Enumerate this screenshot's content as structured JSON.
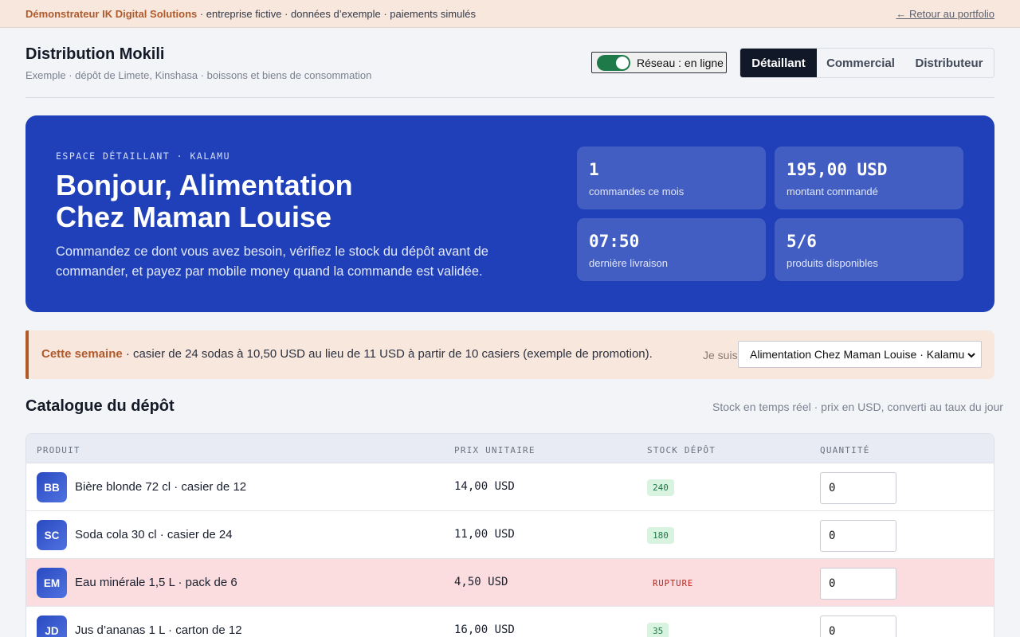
{
  "demo_bar": {
    "brand": "Démonstrateur IK Digital Solutions",
    "notes": " · entreprise fictive · données d’exemple · paiements simulés",
    "back_link": "← Retour au portfolio"
  },
  "header": {
    "title": "Distribution Mokili",
    "subtitle": "Exemple · dépôt de Limete, Kinshasa · boissons et biens de consommation",
    "network": {
      "label": "Réseau : en ligne",
      "on": true,
      "color": "#1f7a4a"
    },
    "roles": [
      "Détaillant",
      "Commercial",
      "Distributeur"
    ],
    "active_role": "Détaillant"
  },
  "hero": {
    "eyebrow": "ESPACE DÉTAILLANT · KALAMU",
    "title": "Bonjour, Alimentation Chez Maman Louise",
    "description": "Commandez ce dont vous avez besoin, vérifiez le stock du dépôt avant de commander, et payez par mobile money quand la commande est validée.",
    "stats": [
      {
        "value": "1",
        "label": "commandes ce mois"
      },
      {
        "value": "195,00 USD",
        "label": "montant commandé"
      },
      {
        "value": "07:50",
        "label": "dernière livraison"
      },
      {
        "value": "5/6",
        "label": "produits disponibles"
      }
    ]
  },
  "promo": {
    "title": "Cette semaine",
    "text": " · casier de 24 sodas à 10,50 USD au lieu de 11 USD à partir de 10 casiers (exemple de promotion).",
    "iam_label": "Je suis",
    "selected": "Alimentation Chez Maman Louise · Kalamu"
  },
  "catalog": {
    "title": "Catalogue du dépôt",
    "subtitle": "Stock en temps réel · prix en USD, converti au taux du jour",
    "columns": [
      "PRODUIT",
      "PRIX UNITAIRE",
      "STOCK DÉPÔT",
      "QUANTITÉ"
    ],
    "rows": [
      {
        "initials": "BB",
        "name": "Bière blonde 72 cl · casier de 12",
        "price": "14,00 USD",
        "stock": "240",
        "qty": "0"
      },
      {
        "initials": "SC",
        "name": "Soda cola 30 cl · casier de 24",
        "price": "11,00 USD",
        "stock": "180",
        "qty": "0"
      },
      {
        "initials": "EM",
        "name": "Eau minérale 1,5 L · pack de 6",
        "price": "4,50 USD",
        "stock": "RUPTURE",
        "qty": "0"
      },
      {
        "initials": "JD",
        "name": "Jus d’ananas 1 L · carton de 12",
        "price": "16,00 USD",
        "stock": "35",
        "qty": "0"
      }
    ]
  },
  "colors": {
    "hero": "#1f40b8",
    "accent": "#b05a2c",
    "in_stock": "#1f7a45",
    "out_of_stock": "#b3261e"
  }
}
